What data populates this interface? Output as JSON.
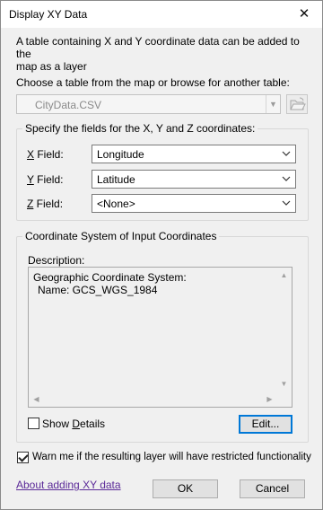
{
  "window": {
    "title": "Display XY Data",
    "close_glyph": "✕"
  },
  "intro": {
    "line1": "A table containing X and Y coordinate data can be added to the",
    "line2": "map as a layer"
  },
  "table_chooser": {
    "label": "Choose a table from the map or browse for another table:",
    "value": "CityData.CSV",
    "enabled": false
  },
  "fields_group": {
    "label": "Specify the fields for the X, Y and Z coordinates:",
    "x": {
      "accel": "X",
      "rest": " Field:",
      "value": "Longitude"
    },
    "y": {
      "accel": "Y",
      "rest": " Field:",
      "value": "Latitude"
    },
    "z": {
      "accel": "Z",
      "rest": " Field:",
      "value": "<None>"
    }
  },
  "coord_group": {
    "label": "Coordinate System of Input Coordinates",
    "description_label": "Description:",
    "description_line1": "Geographic Coordinate System:",
    "description_line2": "Name: GCS_WGS_1984",
    "show_details": {
      "label": "Show Details",
      "accel": "D",
      "checked": false
    },
    "edit_button": "Edit..."
  },
  "warn": {
    "label": "Warn me if the resulting layer will have restricted functionality",
    "checked": true
  },
  "footer": {
    "help_link": "About adding XY data",
    "ok": "OK",
    "cancel": "Cancel"
  },
  "icons": {
    "browse": "folder-open-icon",
    "close": "close-icon",
    "dropdown": "chevron-down-icon"
  },
  "colors": {
    "focus_border": "#0078d7",
    "link": "#5b2a98"
  }
}
